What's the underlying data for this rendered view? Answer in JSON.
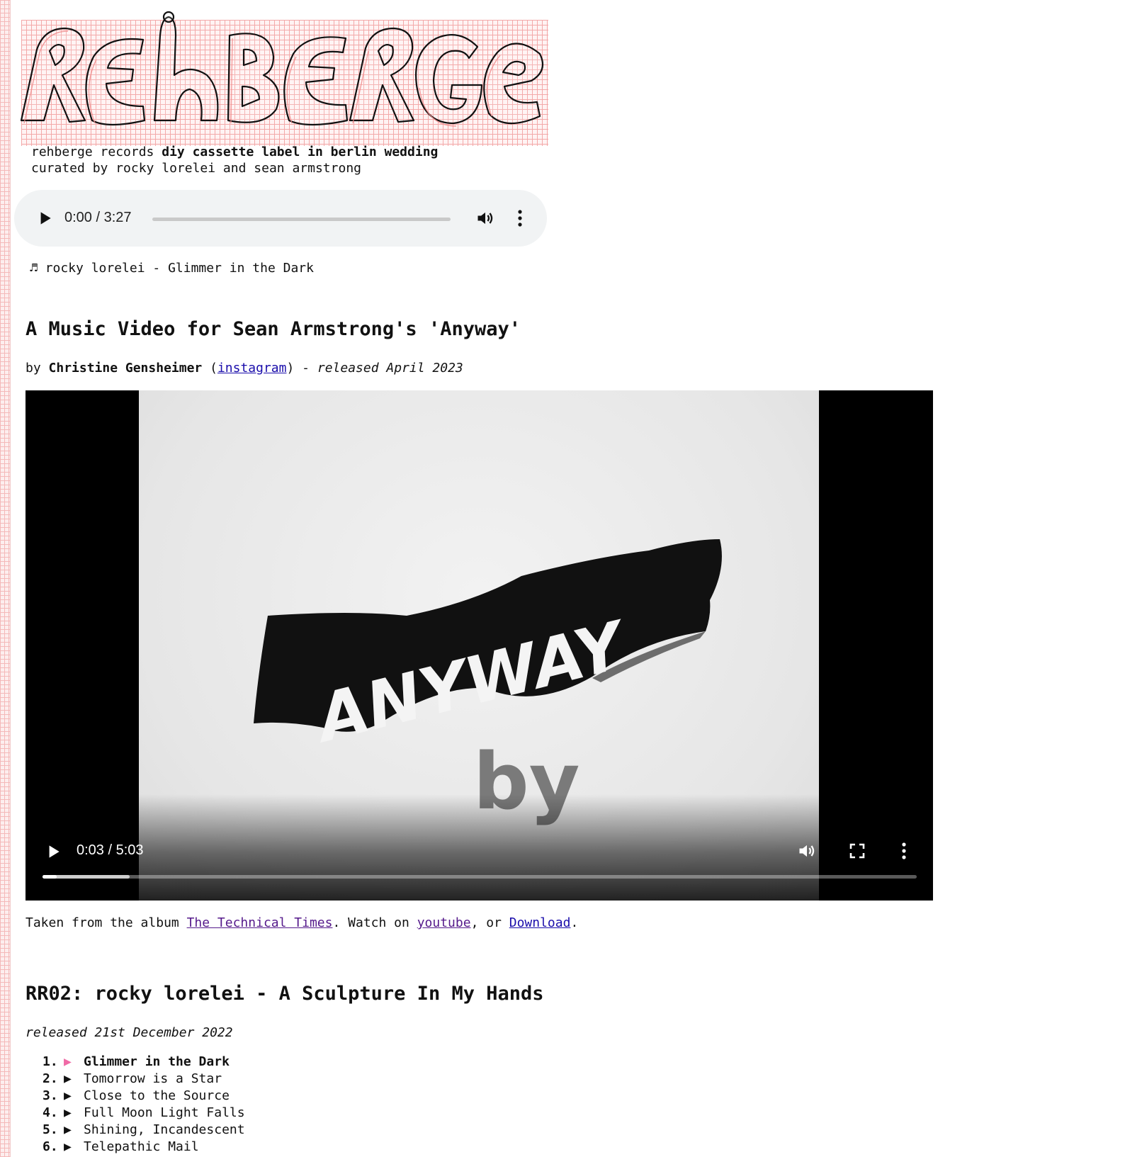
{
  "header": {
    "logo_text": "REHBERGE",
    "tagline_plain": "rehberge records ",
    "tagline_bold": "diy cassette label in berlin wedding",
    "curated_by": "curated by rocky lorelei and sean armstrong"
  },
  "audio_player": {
    "time": "0:00 / 3:27",
    "progress": 0
  },
  "now_playing": {
    "symbol": "♬",
    "text": "rocky lorelei - Glimmer in the Dark"
  },
  "video_section": {
    "title": "A Music Video for Sean Armstrong's 'Anyway'",
    "by_prefix": "by ",
    "author": "Christine Gensheimer",
    "open_paren": " (",
    "instagram_link": "instagram",
    "close_paren": ") - ",
    "released": "released April 2023",
    "video": {
      "time": "0:03 / 5:03",
      "played_fraction": 0.016,
      "buffered_fraction": 0.1,
      "art_word": "ANYWAY",
      "art_by": "by"
    },
    "caption_prefix": "Taken from the album ",
    "album_link": "The Technical Times",
    "caption_mid": ". Watch on ",
    "youtube_link": "youtube",
    "caption_or": ", or ",
    "download_link": "Download",
    "caption_end": "."
  },
  "album": {
    "title": "RR02: rocky lorelei - A Sculpture In My Hands",
    "released": "released 21st December 2022",
    "tracks": [
      {
        "num": "1.",
        "title": "Glimmer in the Dark",
        "active": true
      },
      {
        "num": "2.",
        "title": "Tomorrow is a Star",
        "active": false
      },
      {
        "num": "3.",
        "title": "Close to the Source",
        "active": false
      },
      {
        "num": "4.",
        "title": "Full Moon Light Falls",
        "active": false
      },
      {
        "num": "5.",
        "title": "Shining, Incandescent",
        "active": false
      },
      {
        "num": "6.",
        "title": "Telepathic Mail",
        "active": false
      }
    ],
    "arrow": "▶"
  },
  "colors": {
    "grid_pink": "#f3a9a9",
    "active_arrow": "#f06aa6",
    "link": "#1a0dab",
    "visited_link": "#551a8b"
  }
}
